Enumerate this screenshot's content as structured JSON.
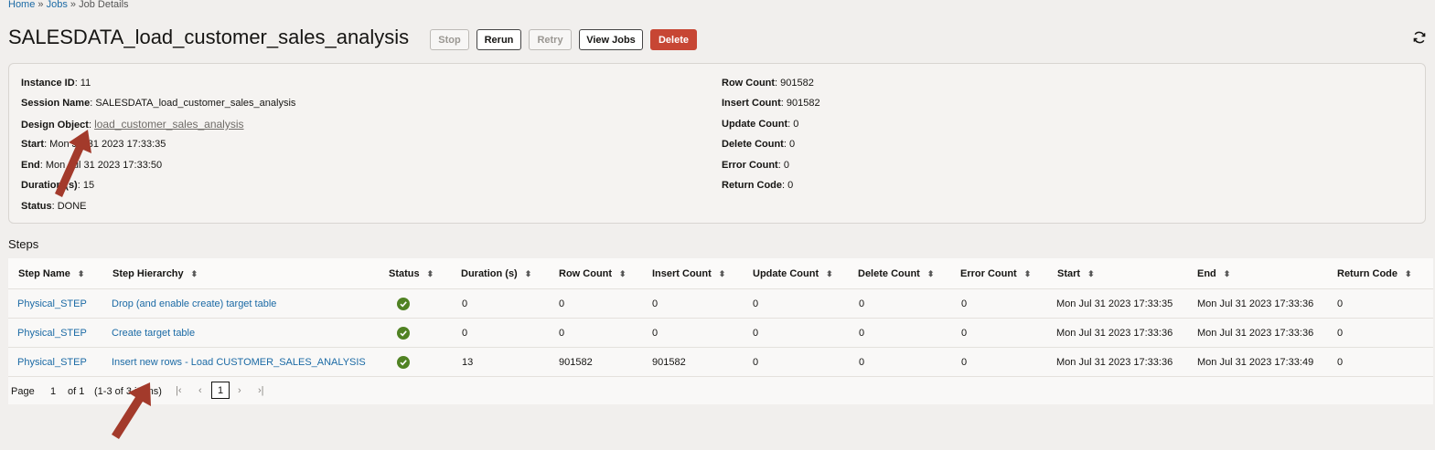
{
  "breadcrumb": {
    "home": "Home",
    "sep1": "»",
    "jobs": "Jobs",
    "sep2": "»",
    "current": "Job Details"
  },
  "title": "SALESDATA_load_customer_sales_analysis",
  "toolbar": {
    "stop": "Stop",
    "rerun": "Rerun",
    "retry": "Retry",
    "view_jobs": "View Jobs",
    "delete": "Delete"
  },
  "details": {
    "instance_id": {
      "label": "Instance ID",
      "value": ": 11"
    },
    "session_name": {
      "label": "Session Name",
      "value": ": SALESDATA_load_customer_sales_analysis"
    },
    "design_object": {
      "label": "Design Object",
      "value": "load_customer_sales_analysis"
    },
    "start": {
      "label": "Start",
      "value": ": Mon Jul 31 2023 17:33:35"
    },
    "end": {
      "label": "End",
      "value": ": Mon Jul 31 2023 17:33:50"
    },
    "duration": {
      "label": "Duration (s)",
      "value": ": 15"
    },
    "status": {
      "label": "Status",
      "value": ": DONE"
    },
    "row_count": {
      "label": "Row Count",
      "value": ": 901582"
    },
    "insert_count": {
      "label": "Insert Count",
      "value": ": 901582"
    },
    "update_count": {
      "label": "Update Count",
      "value": ": 0"
    },
    "delete_count": {
      "label": "Delete Count",
      "value": ": 0"
    },
    "error_count": {
      "label": "Error Count",
      "value": ": 0"
    },
    "return_code": {
      "label": "Return Code",
      "value": ": 0"
    }
  },
  "steps": {
    "heading": "Steps",
    "columns": [
      "Step Name",
      "Step Hierarchy",
      "Status",
      "Duration (s)",
      "Row Count",
      "Insert Count",
      "Update Count",
      "Delete Count",
      "Error Count",
      "Start",
      "End",
      "Return Code"
    ],
    "rows": [
      {
        "name": "Physical_STEP",
        "hierarchy": "Drop (and enable create) target table",
        "status": "success",
        "duration": "0",
        "row_count": "0",
        "insert_count": "0",
        "update_count": "0",
        "delete_count": "0",
        "error_count": "0",
        "start": "Mon Jul 31 2023 17:33:35",
        "end": "Mon Jul 31 2023 17:33:36",
        "return_code": "0"
      },
      {
        "name": "Physical_STEP",
        "hierarchy": "Create target table",
        "status": "success",
        "duration": "0",
        "row_count": "0",
        "insert_count": "0",
        "update_count": "0",
        "delete_count": "0",
        "error_count": "0",
        "start": "Mon Jul 31 2023 17:33:36",
        "end": "Mon Jul 31 2023 17:33:36",
        "return_code": "0"
      },
      {
        "name": "Physical_STEP",
        "hierarchy": "Insert new rows - Load CUSTOMER_SALES_ANALYSIS",
        "status": "success",
        "duration": "13",
        "row_count": "901582",
        "insert_count": "901582",
        "update_count": "0",
        "delete_count": "0",
        "error_count": "0",
        "start": "Mon Jul 31 2023 17:33:36",
        "end": "Mon Jul 31 2023 17:33:49",
        "return_code": "0"
      }
    ]
  },
  "pagination": {
    "page_label": "Page",
    "page_value": "1",
    "of_label": "of 1",
    "range": "(1-3 of 3 items)",
    "current_page": "1"
  },
  "colors": {
    "accent_link": "#1b6aa5",
    "danger": "#c74634",
    "success": "#508223",
    "arrow": "#a33a2b"
  },
  "icons": {
    "refresh": "refresh-icon",
    "status": "check-circle-icon",
    "sort": "sort-icon",
    "first": "first-page-icon",
    "prev": "previous-page-icon",
    "next": "next-page-icon",
    "last": "last-page-icon"
  }
}
